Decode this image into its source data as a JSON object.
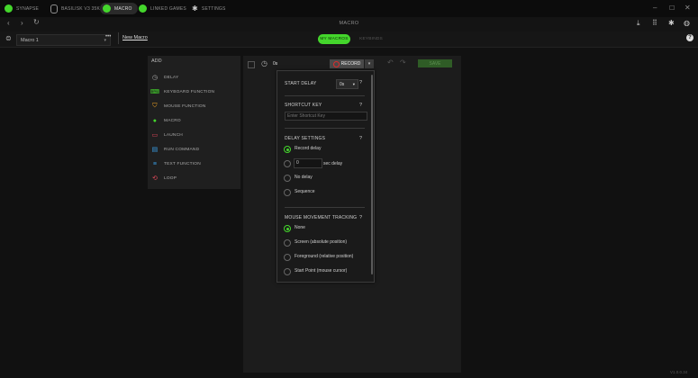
{
  "tabs": [
    {
      "label": "SYNAPSE",
      "icon": "razer-icon",
      "active": false
    },
    {
      "label": "BASILISK V3 35K",
      "icon": "mouse-icon",
      "active": false
    },
    {
      "label": "MACRO",
      "icon": "macro-icon",
      "active": true
    },
    {
      "label": "LINKED GAMES",
      "icon": "gamepad-icon",
      "active": false
    },
    {
      "label": "SETTINGS",
      "icon": "gear-icon",
      "active": false
    }
  ],
  "window_controls": [
    "minimize-icon",
    "maximize-icon",
    "close-icon"
  ],
  "nav": {
    "title": "MACRO"
  },
  "macro_bar": {
    "selected_macro": "Macro 1",
    "more": "•••",
    "new_macro": "New Macro",
    "tabs": [
      "MY MACROS",
      "KEYBINDS"
    ]
  },
  "add_panel": {
    "title": "ADD",
    "items": [
      "DELAY",
      "KEYBOARD FUNCTION",
      "MOUSE FUNCTION",
      "MACRO",
      "LAUNCH",
      "RUN COMMAND",
      "TEXT FUNCTION",
      "LOOP"
    ]
  },
  "editor": {
    "time": "0s",
    "record": "RECORD",
    "save": "SAVE"
  },
  "dropdown": {
    "start_delay_label": "START DELAY",
    "start_delay_value": "0s",
    "shortcut_key_label": "SHORTCUT KEY",
    "shortcut_placeholder": "Enter Shortcut Key",
    "delay_settings_label": "DELAY SETTINGS",
    "delay_options": [
      "Record delay",
      "",
      "No delay",
      "Sequence"
    ],
    "sec_delay_value": "0",
    "sec_delay_label": "sec delay",
    "mouse_tracking_label": "MOUSE MOVEMENT TRACKING",
    "mouse_options": [
      "None",
      "Screen (absolute position)",
      "Foreground (relative position)",
      "Start Point (mouse cursor)"
    ]
  },
  "version": "V1.0.0.34",
  "colors": {
    "accent": "#44d62c",
    "record": "#e02b2b"
  }
}
